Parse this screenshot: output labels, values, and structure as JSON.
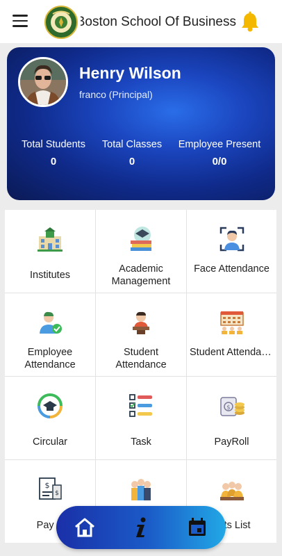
{
  "header": {
    "title": "Boston School Of Business",
    "logo_icon": "school-crest-logo",
    "notification_icon": "bell-icon",
    "accent": "#f5b800"
  },
  "profile": {
    "name": "Henry Wilson",
    "role": "franco (Principal)",
    "stats": [
      {
        "label": "Total Students",
        "value": "0"
      },
      {
        "label": "Total Classes",
        "value": "0"
      },
      {
        "label": "Employee Present",
        "value": "0/0"
      }
    ]
  },
  "modules": [
    {
      "label": "Institutes",
      "icon": "school-building-icon"
    },
    {
      "label": "Academic Management",
      "icon": "books-graduation-icon"
    },
    {
      "label": "Face Attendance",
      "icon": "face-scan-icon"
    },
    {
      "label": "Employee Attendance",
      "icon": "employee-check-icon"
    },
    {
      "label": "Student Attendance",
      "icon": "student-desk-icon"
    },
    {
      "label": "Student Attendance...",
      "icon": "calendar-students-icon"
    },
    {
      "label": "Circular",
      "icon": "circular-graduation-icon"
    },
    {
      "label": "Task",
      "icon": "task-list-icon"
    },
    {
      "label": "PayRoll",
      "icon": "payroll-coins-icon"
    },
    {
      "label": "Pay S",
      "icon": "pay-slip-icon"
    },
    {
      "label": "",
      "icon": "staff-group-icon"
    },
    {
      "label": "ents List",
      "icon": "students-list-icon"
    }
  ],
  "bottom_nav": [
    {
      "name": "home",
      "icon": "home-icon"
    },
    {
      "name": "info",
      "icon": "info-icon"
    },
    {
      "name": "calendar",
      "icon": "calendar-icon"
    }
  ]
}
